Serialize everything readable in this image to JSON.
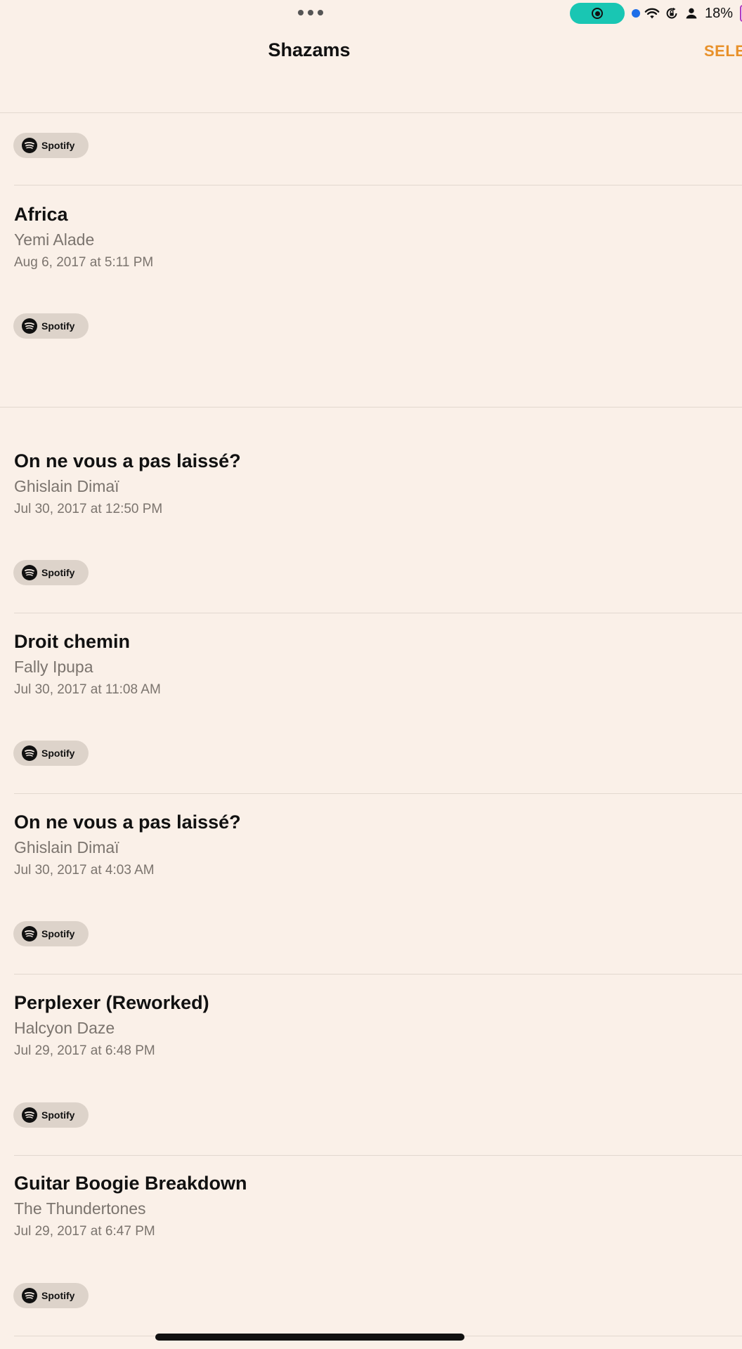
{
  "status_bar": {
    "battery_percent": "18%",
    "icons": [
      "more-dots-icon",
      "screen-record-icon",
      "location-dot-icon",
      "wifi-icon",
      "rotation-lock-icon",
      "person-icon",
      "battery-icon"
    ]
  },
  "nav": {
    "title": "Shazams",
    "select_label": "SELE"
  },
  "spotify_label": "Spotify",
  "items": [
    {
      "title": "Africa",
      "artist": "Yemi Alade",
      "date": "Aug 6, 2017 at 5:11 PM"
    },
    {
      "title": "On ne vous a pas laissé?",
      "artist": "Ghislain Dimaï",
      "date": "Jul 30, 2017 at 12:50 PM"
    },
    {
      "title": "Droit chemin",
      "artist": "Fally Ipupa",
      "date": "Jul 30, 2017 at 11:08 AM"
    },
    {
      "title": "On ne vous a pas laissé?",
      "artist": "Ghislain Dimaï",
      "date": "Jul 30, 2017 at 4:03 AM"
    },
    {
      "title": "Perplexer (Reworked)",
      "artist": "Halcyon Daze",
      "date": "Jul 29, 2017 at 6:48 PM"
    },
    {
      "title": "Guitar Boogie Breakdown",
      "artist": "The Thundertones",
      "date": "Jul 29, 2017 at 6:47 PM"
    }
  ],
  "colors": {
    "background": "#faf0e8",
    "accent": "#e8912a",
    "record_pill": "#19c6b3",
    "secondary_text": "#7b746e"
  }
}
